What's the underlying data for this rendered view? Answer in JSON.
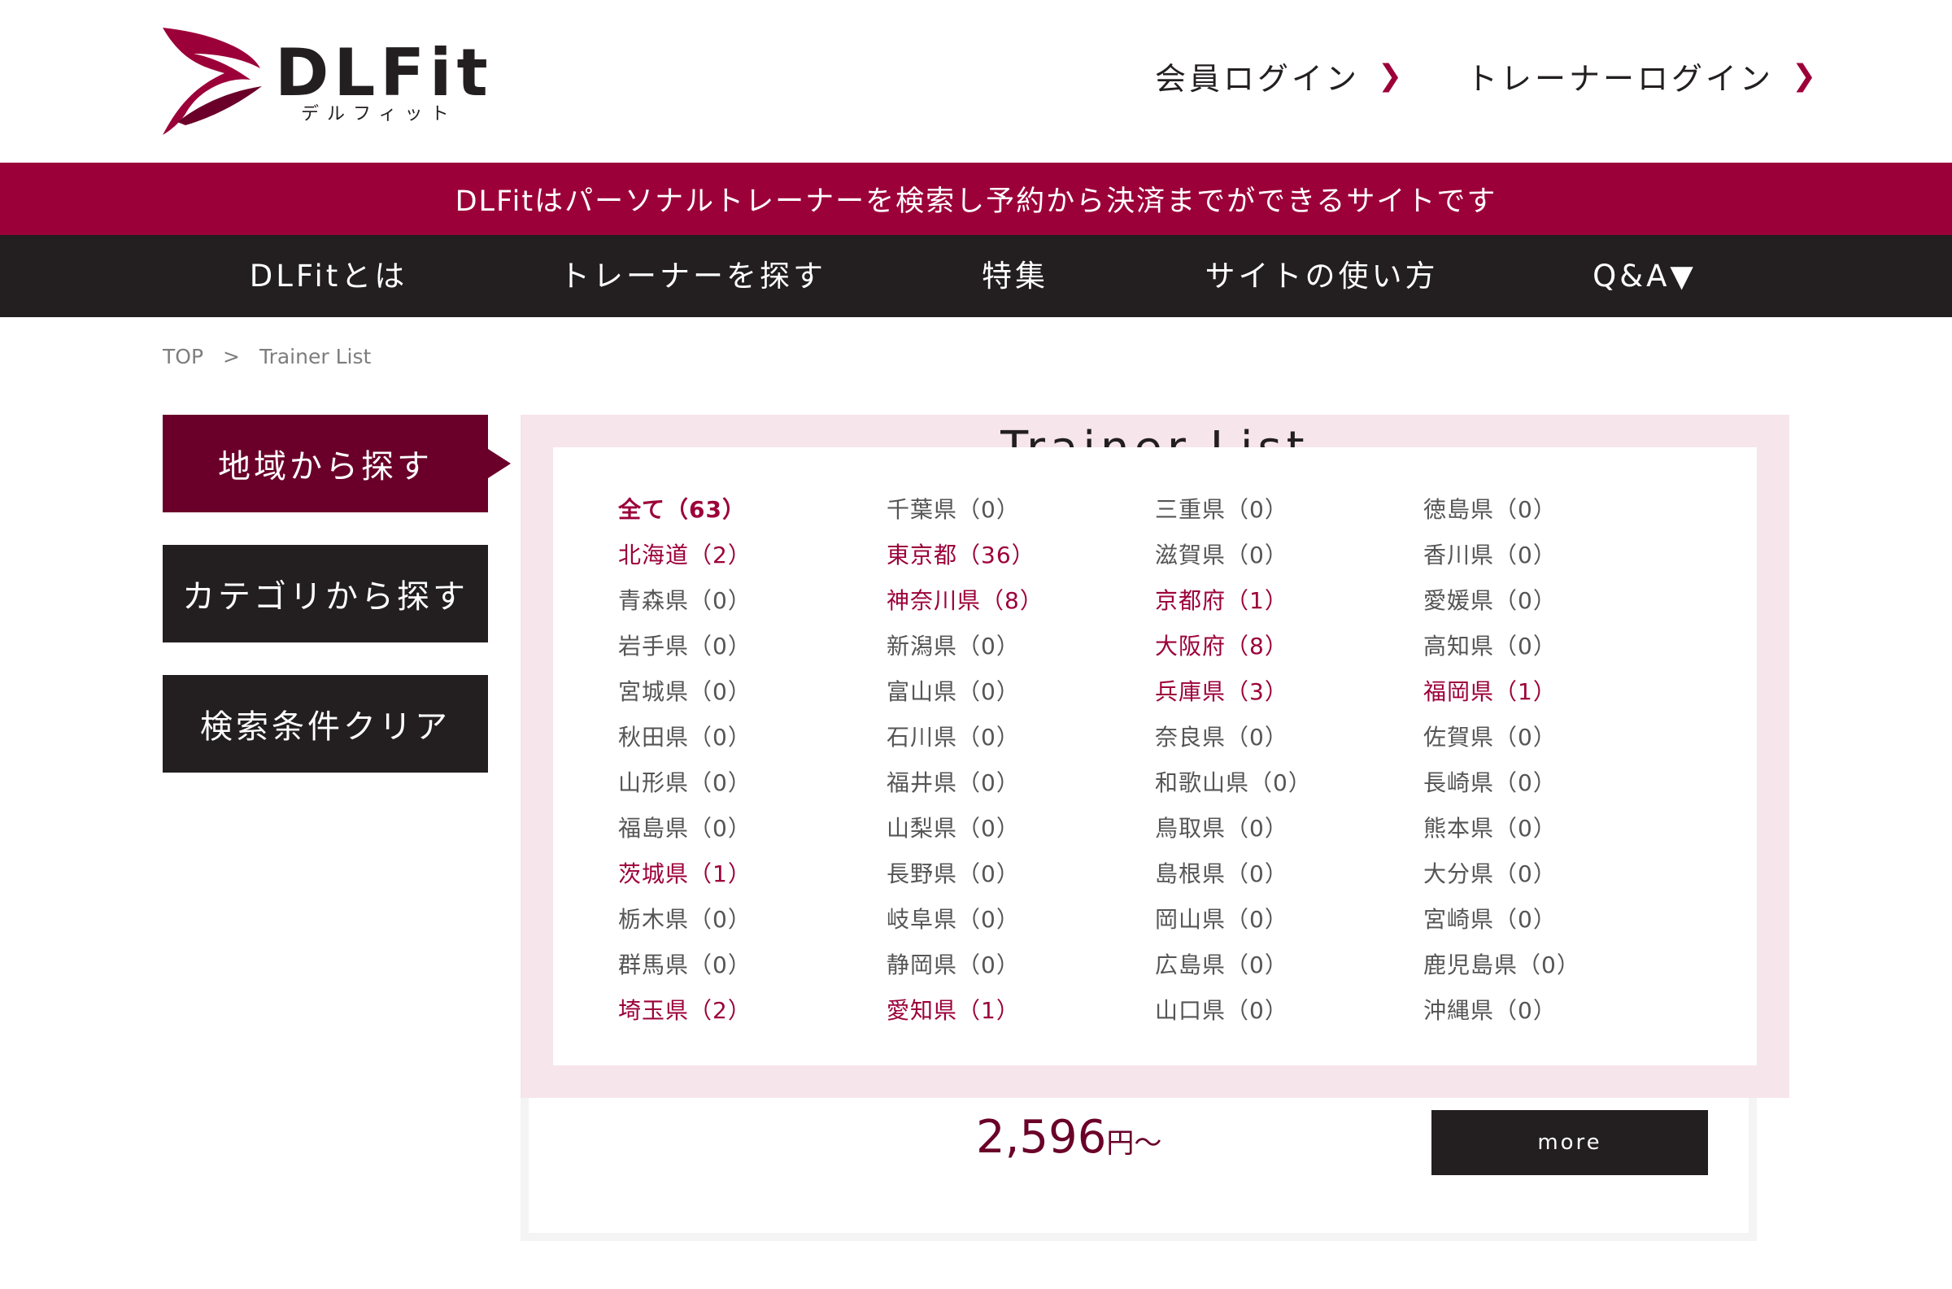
{
  "header": {
    "logo_text": "DLFit",
    "logo_sub": "デルフィット",
    "member_login": "会員ログイン",
    "trainer_login": "トレーナーログイン"
  },
  "banner": "DLFitはパーソナルトレーナーを検索し予約から決済までができるサイトです",
  "nav": [
    {
      "label": "DLFitとは"
    },
    {
      "label": "トレーナーを探す"
    },
    {
      "label": "特集"
    },
    {
      "label": "サイトの使い方"
    },
    {
      "label": "Q&A▼"
    }
  ],
  "breadcrumb": {
    "top": "TOP",
    "sep": ">",
    "current": "Trainer List"
  },
  "sidebar": {
    "area": "地域から探す",
    "category": "カテゴリから探す",
    "clear": "検索条件クリア"
  },
  "list_title": "Trainer List",
  "card": {
    "price": "2,596",
    "unit": "円〜",
    "more": "more"
  },
  "prefectures": [
    [
      "全て（63）",
      "北海道（2）",
      "青森県（0）",
      "岩手県（0）",
      "宮城県（0）",
      "秋田県（0）",
      "山形県（0）",
      "福島県（0）",
      "茨城県（1）",
      "栃木県（0）",
      "群馬県（0）",
      "埼玉県（2）"
    ],
    [
      "千葉県（0）",
      "東京都（36）",
      "神奈川県（8）",
      "新潟県（0）",
      "富山県（0）",
      "石川県（0）",
      "福井県（0）",
      "山梨県（0）",
      "長野県（0）",
      "岐阜県（0）",
      "静岡県（0）",
      "愛知県（1）"
    ],
    [
      "三重県（0）",
      "滋賀県（0）",
      "京都府（1）",
      "大阪府（8）",
      "兵庫県（3）",
      "奈良県（0）",
      "和歌山県（0）",
      "鳥取県（0）",
      "島根県（0）",
      "岡山県（0）",
      "広島県（0）",
      "山口県（0）"
    ],
    [
      "徳島県（0）",
      "香川県（0）",
      "愛媛県（0）",
      "高知県（0）",
      "福岡県（1）",
      "佐賀県（0）",
      "長崎県（0）",
      "熊本県（0）",
      "大分県（0）",
      "宮崎県（0）",
      "鹿児島県（0）",
      "沖縄県（0）"
    ]
  ],
  "colors": {
    "brand": "#9c0039",
    "brand_dark": "#6a0029",
    "dark": "#231f20",
    "pink": "#f6e5ea"
  }
}
